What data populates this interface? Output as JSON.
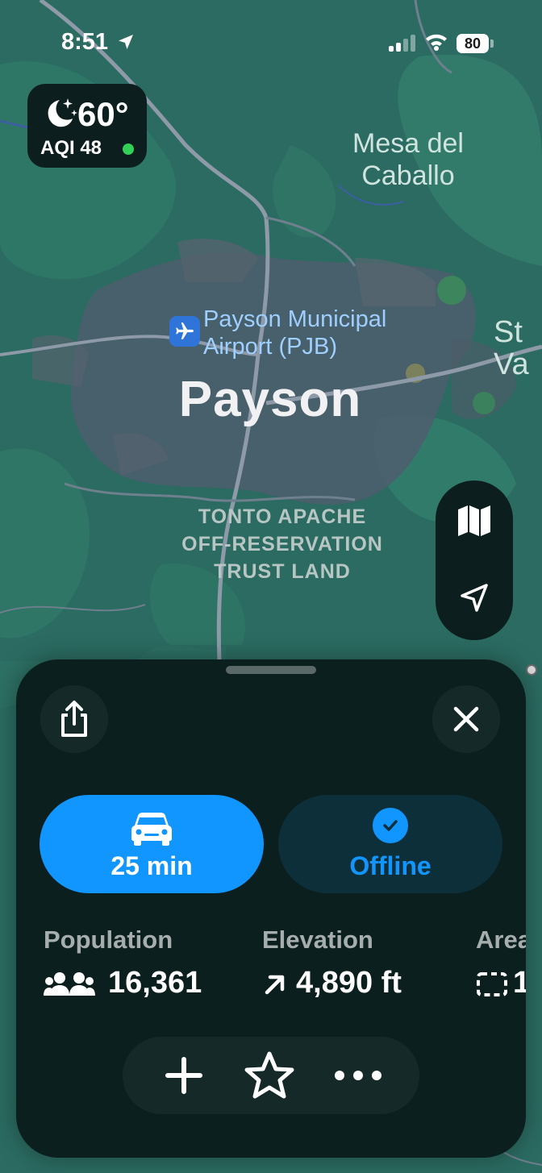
{
  "status_bar": {
    "time": "8:51",
    "battery": "80"
  },
  "weather": {
    "temperature": "60°",
    "aqi": "AQI 48",
    "aqi_color": "#31d158"
  },
  "map": {
    "labels": {
      "mesa_del_caballo": "Mesa del\nCaballo",
      "airport": "Payson Municipal\nAirport (PJB)",
      "city": "Payson",
      "trust_land": "TONTO APACHE\nOFF-RESERVATION\nTRUST LAND",
      "edge_label": "St\nVa"
    },
    "controls": [
      "map-mode",
      "current-location"
    ]
  },
  "sheet": {
    "directions_button": {
      "label": "25 min",
      "icon": "car-icon"
    },
    "offline_button": {
      "label": "Offline",
      "icon": "checkmark-icon"
    },
    "stats": [
      {
        "title": "Population",
        "value": "16,361",
        "icon": "people-icon"
      },
      {
        "title": "Elevation",
        "value": "4,890 ft",
        "icon": "arrow-up-right-icon"
      },
      {
        "title": "Area",
        "value": "1",
        "icon": "area-icon"
      }
    ],
    "actions": [
      "add",
      "favorite",
      "more"
    ]
  },
  "colors": {
    "accent": "#1196ff",
    "sheet_bg": "#0b1f1e",
    "map_bg": "#2a6a60"
  }
}
